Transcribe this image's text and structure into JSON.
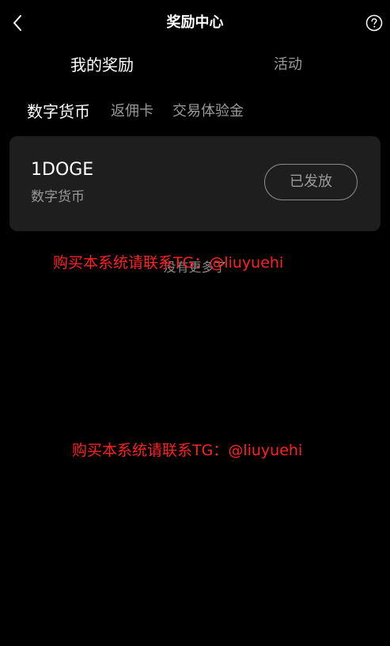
{
  "header": {
    "back_icon": "chevron-left-icon",
    "title": "奖励中心",
    "help_icon": "question-circle-icon"
  },
  "main_tabs": [
    {
      "label": "我的奖励",
      "active": true
    },
    {
      "label": "活动",
      "active": false
    }
  ],
  "sub_tabs": [
    {
      "label": "数字货币",
      "active": true
    },
    {
      "label": "返佣卡",
      "active": false
    },
    {
      "label": "交易体验金",
      "active": false
    }
  ],
  "rewards": [
    {
      "amount": "1DOGE",
      "type": "数字货币",
      "status": "已发放"
    }
  ],
  "list_end_text": "没有更多了",
  "watermarks": [
    "购买本系统请联系TG：@liuyuehi",
    "购买本系统请联系TG：@liuyuehi"
  ],
  "colors": {
    "background": "#000000",
    "card": "#1e1e1e",
    "text_primary": "#ffffff",
    "text_secondary": "#9a9a9a",
    "watermark": "#ff2020"
  }
}
